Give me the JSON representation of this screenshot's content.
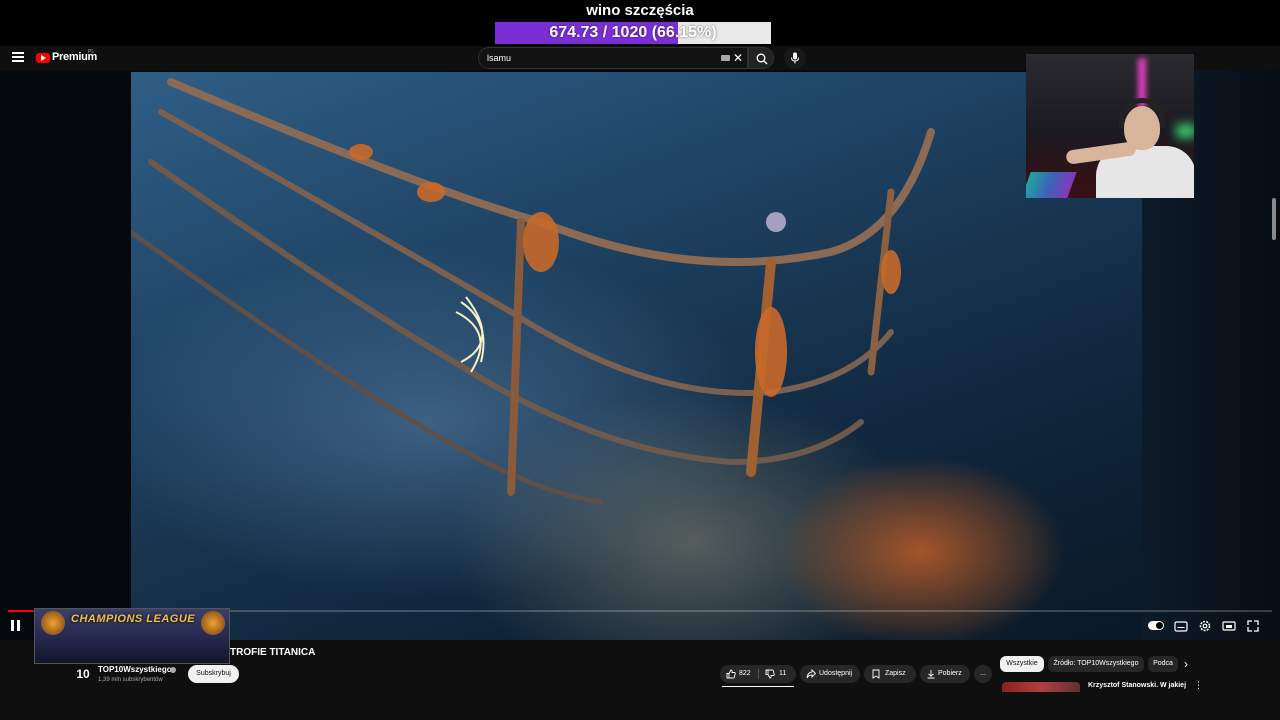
{
  "overlay": {
    "goal_title": "wino szczęścia",
    "goal_text": "674.73 / 1020 (66.15%)",
    "goal_progress": 0.6615,
    "goal_color": "#7a2fd6"
  },
  "masthead": {
    "premium_label": "Premium",
    "region_label": "PL",
    "search_value": "lsamu"
  },
  "player": {
    "progress_played": 0.02,
    "video_title": "TROFIE TITANICA",
    "thumbnail_title": "CHAMPIONS LEAGUE"
  },
  "channel": {
    "logo_text": "10",
    "name": "TOP10Wszystkiego",
    "subscribers": "1,39 mln subskrybentów",
    "subscribe_label": "Subskrybuj"
  },
  "actions": {
    "likes": "822",
    "dislikes": "11",
    "share": "Udostępnij",
    "save": "Zapisz",
    "download": "Pobierz",
    "more": "..."
  },
  "chips": {
    "all": "Wszystkie",
    "source": "Źródło: TOP10Wszystkiego",
    "podcasts": "Podca"
  },
  "recommendation": {
    "title": "Krzysztof Stanowski. W jakiej"
  },
  "colors": {
    "accent": "#ff0000",
    "background": "#0f0f0f"
  }
}
